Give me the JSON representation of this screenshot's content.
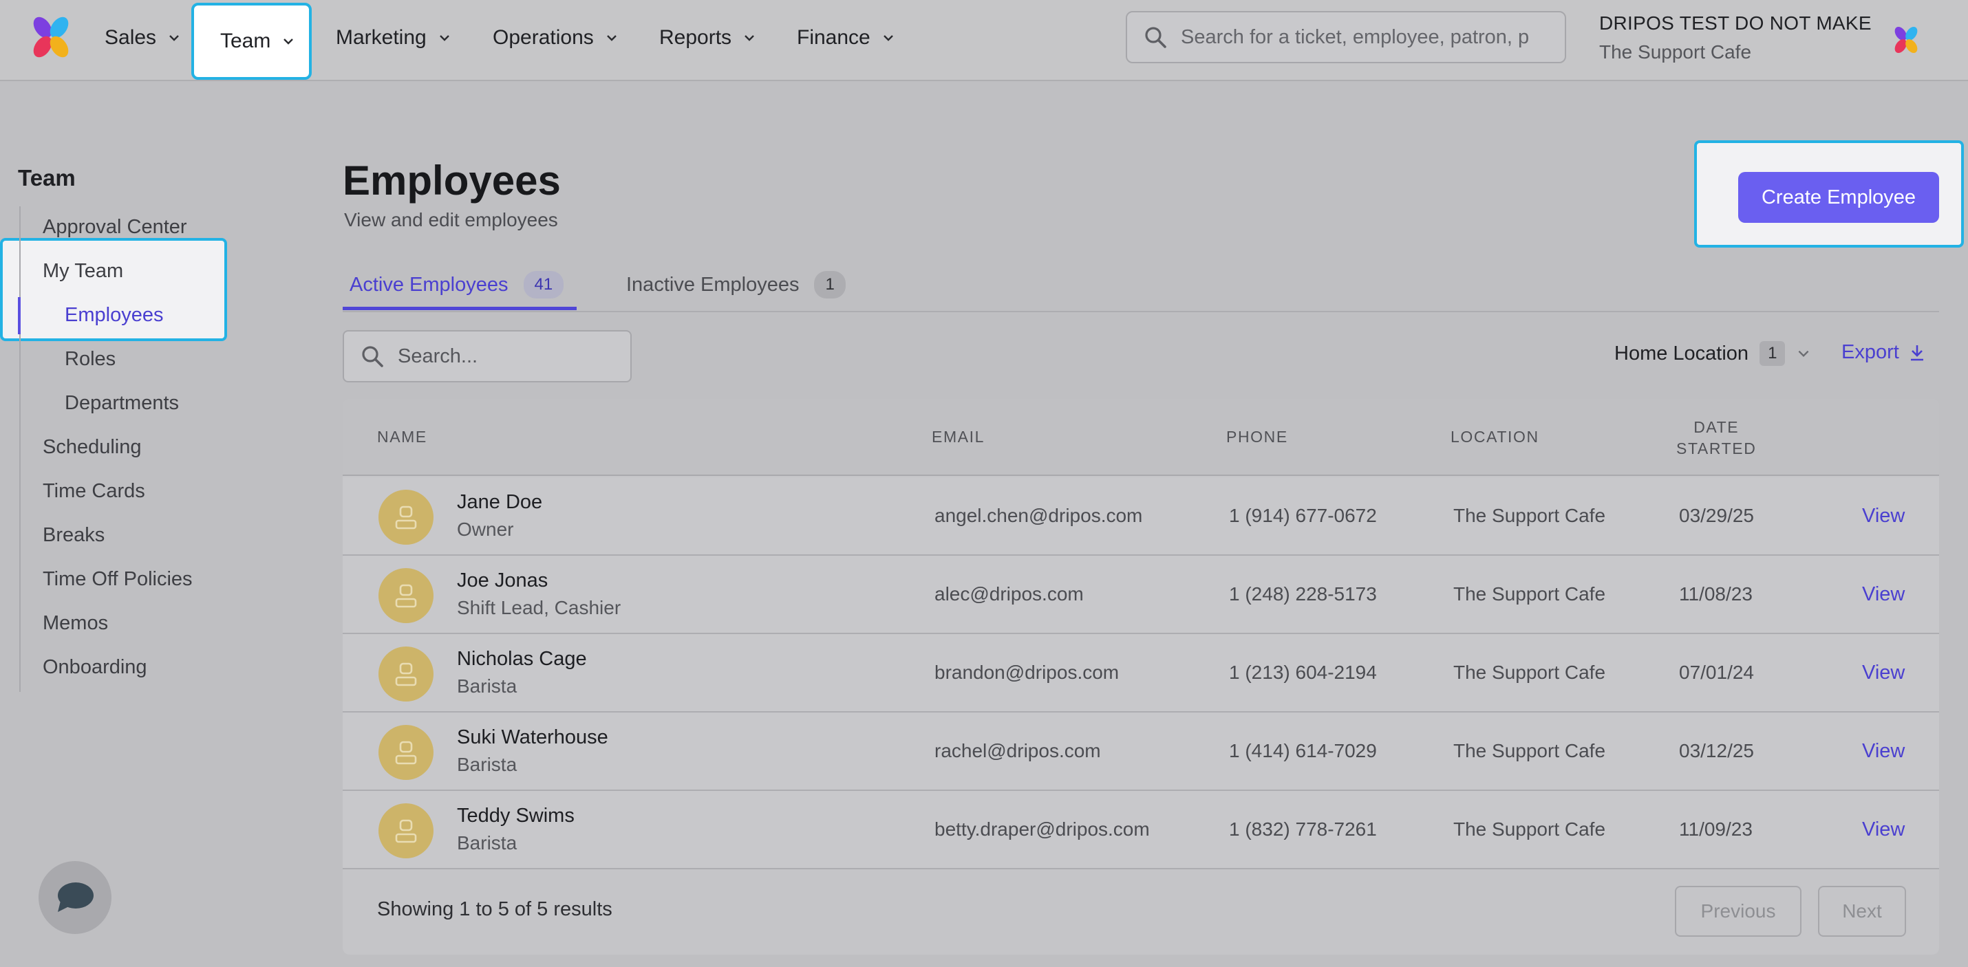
{
  "nav": {
    "items": [
      {
        "label": "Sales"
      },
      {
        "label": "Team"
      },
      {
        "label": "Marketing"
      },
      {
        "label": "Operations"
      },
      {
        "label": "Reports"
      },
      {
        "label": "Finance"
      }
    ],
    "active": "Team",
    "search_placeholder": "Search for a ticket, employee, patron, p",
    "account_name": "DRIPOS TEST DO NOT MAKE",
    "account_location": "The Support Cafe"
  },
  "sidebar": {
    "title": "Team",
    "items": [
      {
        "label": "Approval Center"
      },
      {
        "label": "My Team"
      },
      {
        "label": "Employees"
      },
      {
        "label": "Roles"
      },
      {
        "label": "Departments"
      },
      {
        "label": "Scheduling"
      },
      {
        "label": "Time Cards"
      },
      {
        "label": "Breaks"
      },
      {
        "label": "Time Off Policies"
      },
      {
        "label": "Memos"
      },
      {
        "label": "Onboarding"
      }
    ]
  },
  "page": {
    "title": "Employees",
    "subtitle": "View and edit employees",
    "create_button": "Create Employee",
    "tabs": [
      {
        "label": "Active Employees",
        "count": "41"
      },
      {
        "label": "Inactive Employees",
        "count": "1"
      }
    ],
    "search_placeholder": "Search...",
    "filter_label": "Home Location",
    "filter_count": "1",
    "export_label": "Export"
  },
  "table": {
    "headers": {
      "name": "NAME",
      "email": "EMAIL",
      "phone": "PHONE",
      "location": "LOCATION",
      "date_line1": "DATE",
      "date_line2": "STARTED"
    },
    "rows": [
      {
        "name": "Jane Doe",
        "role": "Owner",
        "email": "angel.chen@dripos.com",
        "phone": "1 (914) 677-0672",
        "location": "The Support Cafe",
        "date": "03/29/25",
        "action": "View"
      },
      {
        "name": "Joe Jonas",
        "role": "Shift Lead, Cashier",
        "email": "alec@dripos.com",
        "phone": "1 (248) 228-5173",
        "location": "The Support Cafe",
        "date": "11/08/23",
        "action": "View"
      },
      {
        "name": "Nicholas Cage",
        "role": "Barista",
        "email": "brandon@dripos.com",
        "phone": "1 (213) 604-2194",
        "location": "The Support Cafe",
        "date": "07/01/24",
        "action": "View"
      },
      {
        "name": "Suki Waterhouse",
        "role": "Barista",
        "email": "rachel@dripos.com",
        "phone": "1 (414) 614-7029",
        "location": "The Support Cafe",
        "date": "03/12/25",
        "action": "View"
      },
      {
        "name": "Teddy Swims",
        "role": "Barista",
        "email": "betty.draper@dripos.com",
        "phone": "1 (832) 778-7261",
        "location": "The Support Cafe",
        "date": "11/09/23",
        "action": "View"
      }
    ],
    "footer_text": "Showing 1 to 5 of 5 results",
    "prev_label": "Previous",
    "next_label": "Next"
  },
  "icons": {
    "logo": "dripos-flower-logo",
    "search": "search-icon",
    "chevron": "chevron-down-icon",
    "export": "download-icon",
    "avatar": "person-icon",
    "chat": "chat-bubble-icon"
  },
  "colors": {
    "accent": "#6a5ff0",
    "link": "#4a3fd0",
    "highlight": "#23b2e4",
    "avatar": "#cdb469"
  }
}
